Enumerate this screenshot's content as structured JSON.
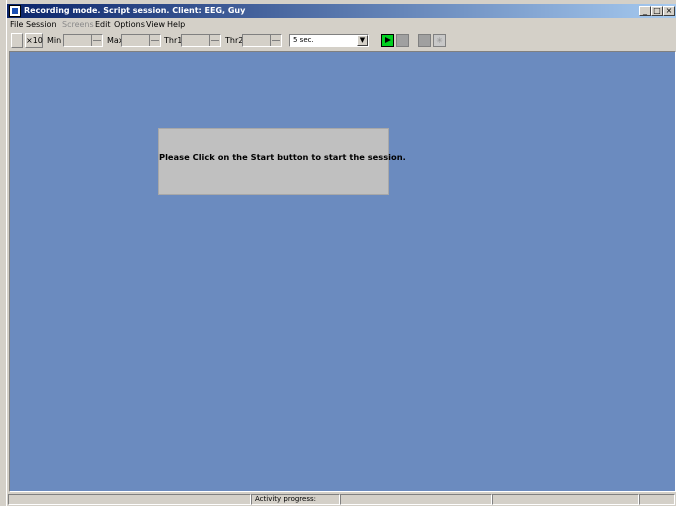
{
  "window": {
    "title": "Recording mode. Script session. Client: EEG, Guy",
    "controls": [
      "_",
      "□",
      "×"
    ]
  },
  "menu": [
    {
      "label": "File",
      "enabled": true
    },
    {
      "label": "Session",
      "enabled": true
    },
    {
      "label": "Screens",
      "enabled": false
    },
    {
      "label": "Edit",
      "enabled": true
    },
    {
      "label": "Options",
      "enabled": true
    },
    {
      "label": "View",
      "enabled": true
    },
    {
      "label": "Help",
      "enabled": true
    }
  ],
  "toolbar": {
    "scale_label": "×10",
    "min_label": "Min",
    "max_label": "Max",
    "thr1_label": "Thr1",
    "thr2_label": "Thr2",
    "interval_value": "5 sec.",
    "min_value": "",
    "max_value": "",
    "thr1_value": "",
    "thr2_value": ""
  },
  "message": {
    "text": "Please Click on the Start button to start the session."
  },
  "statusbar": {
    "activity_label": "Activity progress:"
  },
  "colors": {
    "workspace": "#6b8bbf",
    "play_button": "#00d020",
    "title_gradient_start": "#0a246a",
    "title_gradient_end": "#a6caf0"
  }
}
